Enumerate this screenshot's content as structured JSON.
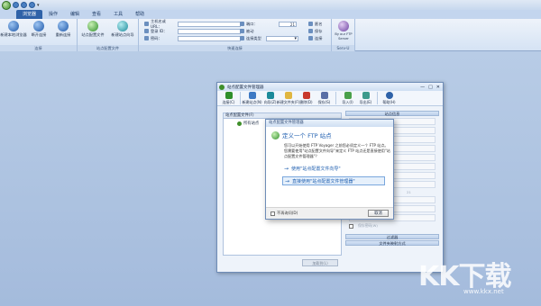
{
  "tabs": [
    "浏览器",
    "操作",
    "编辑",
    "查看",
    "工具",
    "帮助"
  ],
  "ribbon": {
    "connect_group": {
      "label": "连接",
      "buttons": [
        "新建本地浏览器",
        "断开连接",
        "重新连接"
      ]
    },
    "site_group": {
      "label": "站点配置文件",
      "buttons": [
        "站点配置文件",
        "新建站点向导"
      ]
    },
    "quick_group": {
      "label": "快速连接",
      "host_label": "主机名或 URL：",
      "login_label": "登录 ID：",
      "password_label": "密码：",
      "port_label": "端口：",
      "port_value": "21",
      "proxy_label": "匿名",
      "save_label": "保存",
      "passive_label": "被动",
      "conn_type_label": "连接类型",
      "connect_label": "连接"
    },
    "serv_group": {
      "label": "Serv-U",
      "button": "By our FTP Server"
    }
  },
  "window": {
    "title": "站点配置文件管理器",
    "controls": [
      "—",
      "□",
      "✕"
    ],
    "toolbar": [
      "连接(C)",
      "新建站点(N)",
      "向导(Z)",
      "新建文件夹(F)",
      "删除(D)",
      "保存(S)",
      "导入(I)",
      "导出(E)",
      "帮助(H)"
    ],
    "left_header": "站点配置文件(F)",
    "tree_root": "所有站点",
    "left_button": "加载到(L)",
    "right_header": "站点信息",
    "right_port": "21",
    "right_bars": [
      "过滤器",
      "文件夹映射方式"
    ],
    "right_checkbox": "保存密码(W)"
  },
  "dialog": {
    "title": "站点配置文件管理器",
    "heading": "定义一个 FTP 站点",
    "text": "您可以开始使用 FTP Voyager 之前您必须定义一个 FTP 站点。您需要使用\"站点配置文件向导\"来定义 FTP 站点还是直接使用\"站点配置文件管理器\"？",
    "option1": "使用\"站点配置文件向导\"",
    "option2": "直接使用\"站点配置文件管理器\"",
    "checkbox": "不再询问(D)",
    "cancel": "取消"
  },
  "watermark": {
    "main": "KK下载",
    "sub": "www.kkx.net"
  }
}
